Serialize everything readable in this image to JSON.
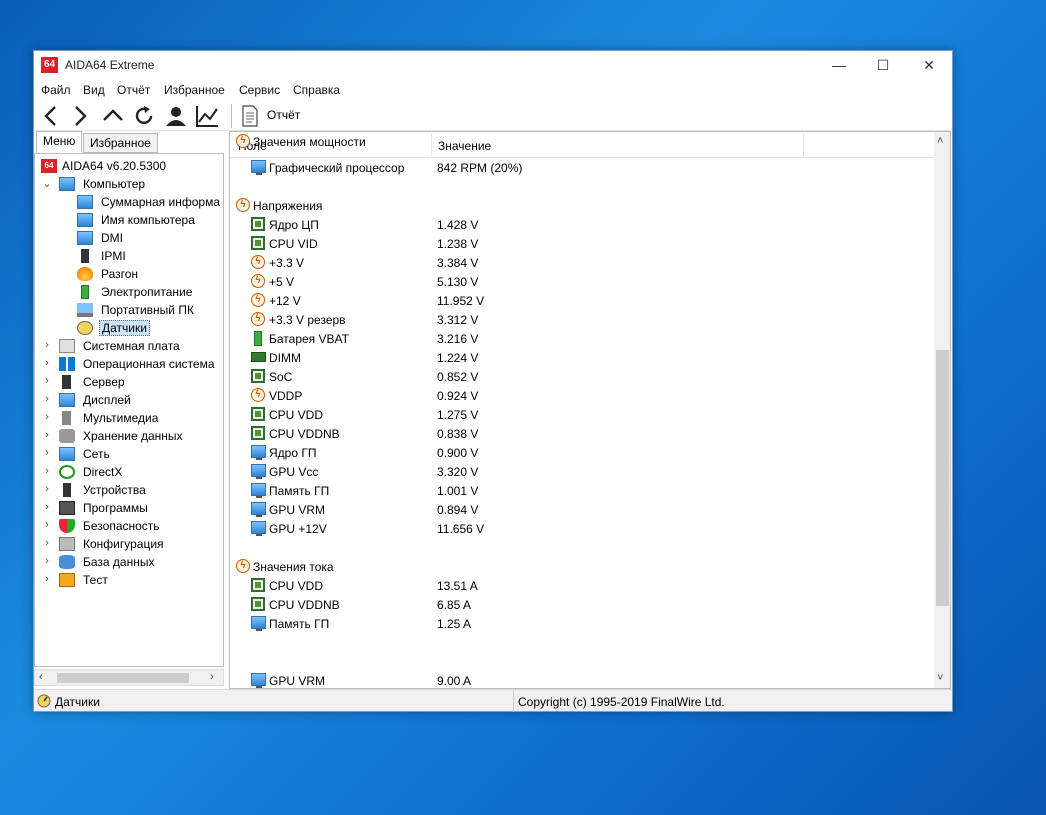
{
  "window": {
    "title": "AIDA64 Extreme",
    "app_icon_text": "64"
  },
  "controls": {
    "minimize": "—",
    "maximize": "☐",
    "close": "✕"
  },
  "menu": [
    "Файл",
    "Вид",
    "Отчёт",
    "Избранное",
    "Сервис",
    "Справка"
  ],
  "toolbar": {
    "report_label": "Отчёт"
  },
  "tabs": {
    "menu": "Меню",
    "favorites": "Избранное"
  },
  "tree": {
    "root": "AIDA64 v6.20.5300",
    "items": [
      {
        "label": "Компьютер",
        "level": 1,
        "expander": "⌄",
        "icon": "computer-icon"
      },
      {
        "label": "Суммарная информа",
        "level": 2,
        "icon": "monitor-icon"
      },
      {
        "label": "Имя компьютера",
        "level": 2,
        "icon": "monitor-icon"
      },
      {
        "label": "DMI",
        "level": 2,
        "icon": "monitor-icon"
      },
      {
        "label": "IPMI",
        "level": 2,
        "icon": "phone-icon"
      },
      {
        "label": "Разгон",
        "level": 2,
        "icon": "flame-icon"
      },
      {
        "label": "Электропитание",
        "level": 2,
        "icon": "battery-icon"
      },
      {
        "label": "Портативный ПК",
        "level": 2,
        "icon": "laptop-icon"
      },
      {
        "label": "Датчики",
        "level": 2,
        "icon": "gauge-icon",
        "selected": true
      },
      {
        "label": "Системная плата",
        "level": 1,
        "expander": "›",
        "icon": "motherboard-icon"
      },
      {
        "label": "Операционная система",
        "level": 1,
        "expander": "›",
        "icon": "windows-icon"
      },
      {
        "label": "Сервер",
        "level": 1,
        "expander": "›",
        "icon": "server-icon"
      },
      {
        "label": "Дисплей",
        "level": 1,
        "expander": "›",
        "icon": "display-icon"
      },
      {
        "label": "Мультимедиа",
        "level": 1,
        "expander": "›",
        "icon": "speaker-icon"
      },
      {
        "label": "Хранение данных",
        "level": 1,
        "expander": "›",
        "icon": "storage-icon"
      },
      {
        "label": "Сеть",
        "level": 1,
        "expander": "›",
        "icon": "network-icon"
      },
      {
        "label": "DirectX",
        "level": 1,
        "expander": "›",
        "icon": "xbox-icon"
      },
      {
        "label": "Устройства",
        "level": 1,
        "expander": "›",
        "icon": "device-icon"
      },
      {
        "label": "Программы",
        "level": 1,
        "expander": "›",
        "icon": "program-icon"
      },
      {
        "label": "Безопасность",
        "level": 1,
        "expander": "›",
        "icon": "shield-icon"
      },
      {
        "label": "Конфигурация",
        "level": 1,
        "expander": "›",
        "icon": "config-icon"
      },
      {
        "label": "База данных",
        "level": 1,
        "expander": "›",
        "icon": "database-icon"
      },
      {
        "label": "Тест",
        "level": 1,
        "expander": "›",
        "icon": "test-icon"
      }
    ]
  },
  "columns": {
    "field": "Поле",
    "value": "Значение"
  },
  "rows": [
    {
      "type": "item",
      "field": "Графический процессор",
      "value": "842 RPM  (20%)",
      "icon": "monitor-icon"
    },
    {
      "type": "group",
      "field": "Напряжения",
      "icon": "bolt-icon"
    },
    {
      "type": "item",
      "field": "Ядро ЦП",
      "value": "1.428 V",
      "icon": "chip-icon"
    },
    {
      "type": "item",
      "field": "CPU VID",
      "value": "1.238 V",
      "icon": "chip-icon"
    },
    {
      "type": "item",
      "field": "+3.3 V",
      "value": "3.384 V",
      "icon": "bolt-icon"
    },
    {
      "type": "item",
      "field": "+5 V",
      "value": "5.130 V",
      "icon": "bolt-icon"
    },
    {
      "type": "item",
      "field": "+12 V",
      "value": "11.952 V",
      "icon": "bolt-icon"
    },
    {
      "type": "item",
      "field": "+3.3 V резерв",
      "value": "3.312 V",
      "icon": "bolt-icon"
    },
    {
      "type": "item",
      "field": "Батарея VBAT",
      "value": "3.216 V",
      "icon": "battery-icon"
    },
    {
      "type": "item",
      "field": "DIMM",
      "value": "1.224 V",
      "icon": "ram-icon"
    },
    {
      "type": "item",
      "field": "SoC",
      "value": "0.852 V",
      "icon": "chip-icon"
    },
    {
      "type": "item",
      "field": "VDDP",
      "value": "0.924 V",
      "icon": "bolt-icon"
    },
    {
      "type": "item",
      "field": "CPU VDD",
      "value": "1.275 V",
      "icon": "chip-icon"
    },
    {
      "type": "item",
      "field": "CPU VDDNB",
      "value": "0.838 V",
      "icon": "chip-icon"
    },
    {
      "type": "item",
      "field": "Ядро ГП",
      "value": "0.900 V",
      "icon": "monitor-icon"
    },
    {
      "type": "item",
      "field": "GPU Vcc",
      "value": "3.320 V",
      "icon": "monitor-icon"
    },
    {
      "type": "item",
      "field": "Память ГП",
      "value": "1.001 V",
      "icon": "monitor-icon"
    },
    {
      "type": "item",
      "field": "GPU VRM",
      "value": "0.894 V",
      "icon": "monitor-icon"
    },
    {
      "type": "item",
      "field": "GPU +12V",
      "value": "11.656 V",
      "icon": "monitor-icon"
    },
    {
      "type": "group",
      "field": "Значения тока",
      "icon": "bolt-icon"
    },
    {
      "type": "item",
      "field": "CPU VDD",
      "value": "13.51 A",
      "icon": "chip-icon"
    },
    {
      "type": "item",
      "field": "CPU VDDNB",
      "value": "6.85 A",
      "icon": "chip-icon"
    },
    {
      "type": "item",
      "field": "Память ГП",
      "value": "1.25 A",
      "icon": "monitor-icon"
    },
    {
      "type": "item",
      "field": "GPU VRM",
      "value": "9.00 A",
      "icon": "monitor-icon"
    },
    {
      "type": "group",
      "field": "Значения мощности",
      "icon": "bolt-icon"
    }
  ],
  "status": {
    "left": "Датчики",
    "right": "Copyright (c) 1995-2019 FinalWire Ltd."
  }
}
